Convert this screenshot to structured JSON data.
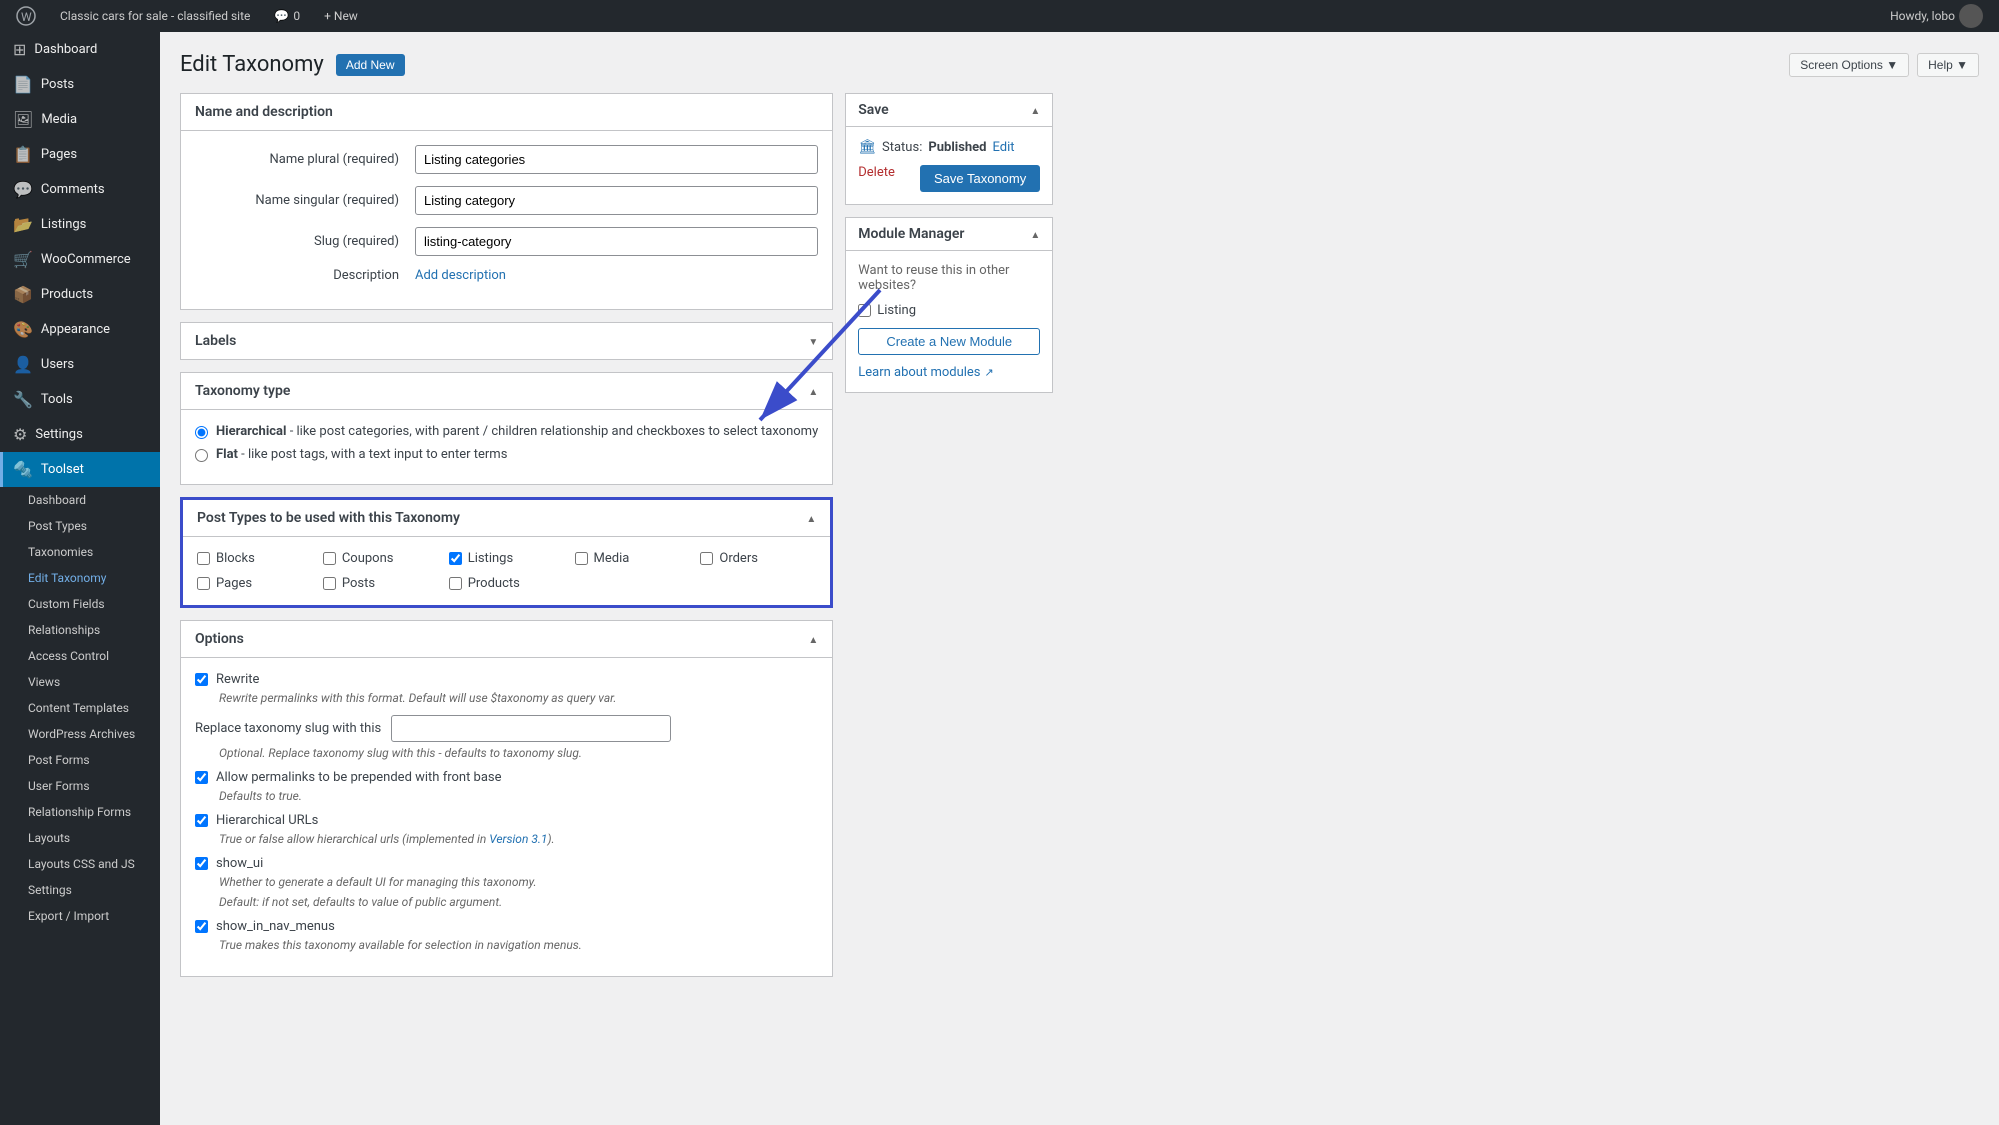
{
  "adminbar": {
    "site_name": "Classic cars for sale - classified site",
    "comments_count": "0",
    "new_label": "+ New",
    "howdy": "Howdy, lobo"
  },
  "sidebar": {
    "items": [
      {
        "id": "dashboard",
        "label": "Dashboard",
        "icon": "⊞"
      },
      {
        "id": "posts",
        "label": "Posts",
        "icon": "📄"
      },
      {
        "id": "media",
        "label": "Media",
        "icon": "🖼"
      },
      {
        "id": "pages",
        "label": "Pages",
        "icon": "📋"
      },
      {
        "id": "comments",
        "label": "Comments",
        "icon": "💬"
      },
      {
        "id": "listings",
        "label": "Listings",
        "icon": "📂"
      },
      {
        "id": "woocommerce",
        "label": "WooCommerce",
        "icon": "🛒"
      },
      {
        "id": "products",
        "label": "Products",
        "icon": "📦"
      },
      {
        "id": "appearance",
        "label": "Appearance",
        "icon": "🎨"
      },
      {
        "id": "users",
        "label": "Users",
        "icon": "👤"
      },
      {
        "id": "tools",
        "label": "Tools",
        "icon": "🔧"
      },
      {
        "id": "settings",
        "label": "Settings",
        "icon": "⚙"
      },
      {
        "id": "toolset",
        "label": "Toolset",
        "icon": "🔩",
        "active": true
      }
    ],
    "submenu": [
      {
        "id": "toolset-dashboard",
        "label": "Dashboard"
      },
      {
        "id": "post-types",
        "label": "Post Types"
      },
      {
        "id": "taxonomies",
        "label": "Taxonomies"
      },
      {
        "id": "edit-taxonomy",
        "label": "Edit Taxonomy",
        "active": true
      },
      {
        "id": "custom-fields",
        "label": "Custom Fields"
      },
      {
        "id": "relationships",
        "label": "Relationships"
      },
      {
        "id": "access-control",
        "label": "Access Control"
      },
      {
        "id": "views",
        "label": "Views"
      },
      {
        "id": "content-templates",
        "label": "Content Templates"
      },
      {
        "id": "wordpress-archives",
        "label": "WordPress Archives"
      },
      {
        "id": "post-forms",
        "label": "Post Forms"
      },
      {
        "id": "user-forms",
        "label": "User Forms"
      },
      {
        "id": "relationship-forms",
        "label": "Relationship Forms"
      },
      {
        "id": "layouts",
        "label": "Layouts"
      },
      {
        "id": "layouts-css-js",
        "label": "Layouts CSS and JS"
      },
      {
        "id": "wp-settings",
        "label": "Settings"
      },
      {
        "id": "export-import",
        "label": "Export / Import"
      }
    ]
  },
  "page": {
    "title": "Edit Taxonomy",
    "add_new_label": "Add New",
    "screen_options_label": "Screen Options ▼",
    "help_label": "Help ▼"
  },
  "name_description": {
    "section_title": "Name and description",
    "name_plural_label": "Name plural (required)",
    "name_plural_value": "Listing categories",
    "name_singular_label": "Name singular (required)",
    "name_singular_value": "Listing category",
    "slug_label": "Slug (required)",
    "slug_value": "listing-category",
    "description_label": "Description",
    "add_description_text": "Add description"
  },
  "labels": {
    "section_title": "Labels"
  },
  "taxonomy_type": {
    "section_title": "Taxonomy type",
    "hierarchical_label": "Hierarchical",
    "hierarchical_desc": "- like post categories, with parent / children relationship and checkboxes to select taxonomy",
    "flat_label": "Flat",
    "flat_desc": "- like post tags, with a text input to enter terms"
  },
  "post_types": {
    "section_title": "Post Types to be used with this Taxonomy",
    "items": [
      {
        "id": "blocks",
        "label": "Blocks",
        "checked": false
      },
      {
        "id": "coupons",
        "label": "Coupons",
        "checked": false
      },
      {
        "id": "listings",
        "label": "Listings",
        "checked": true
      },
      {
        "id": "media",
        "label": "Media",
        "checked": false
      },
      {
        "id": "orders",
        "label": "Orders",
        "checked": false
      },
      {
        "id": "pages",
        "label": "Pages",
        "checked": false
      },
      {
        "id": "posts",
        "label": "Posts",
        "checked": false
      },
      {
        "id": "products",
        "label": "Products",
        "checked": false
      }
    ]
  },
  "options": {
    "section_title": "Options",
    "rewrite_label": "Rewrite",
    "rewrite_checked": true,
    "rewrite_desc": "Rewrite permalinks with this format. Default will use $taxonomy as query var.",
    "replace_slug_label": "Replace taxonomy slug with this",
    "replace_slug_desc": "Optional. Replace taxonomy slug with this - defaults to taxonomy slug.",
    "allow_permalinks_label": "Allow permalinks to be prepended with front base",
    "allow_permalinks_checked": true,
    "allow_permalinks_desc": "Defaults to true.",
    "hierarchical_urls_label": "Hierarchical URLs",
    "hierarchical_urls_checked": true,
    "hierarchical_urls_desc": "True or false allow hierarchical urls (implemented in Version 3.1).",
    "hierarchical_urls_link": "Version 3.1",
    "show_ui_label": "show_ui",
    "show_ui_checked": true,
    "show_ui_desc": "Whether to generate a default UI for managing this taxonomy.",
    "show_ui_desc2": "Default: if not set, defaults to value of public argument.",
    "show_in_nav_menus_label": "show_in_nav_menus",
    "show_in_nav_menus_checked": true,
    "show_in_nav_menus_desc": "True makes this taxonomy available for selection in navigation menus."
  },
  "save_panel": {
    "title": "Save",
    "status_label": "Status:",
    "status_value": "Published",
    "edit_label": "Edit",
    "delete_label": "Delete",
    "save_label": "Save Taxonomy"
  },
  "module_manager": {
    "title": "Module Manager",
    "desc": "Want to reuse this in other websites?",
    "listing_label": "Listing",
    "create_label": "Create a New Module",
    "learn_label": "Learn about modules",
    "external_icon": "↗"
  }
}
